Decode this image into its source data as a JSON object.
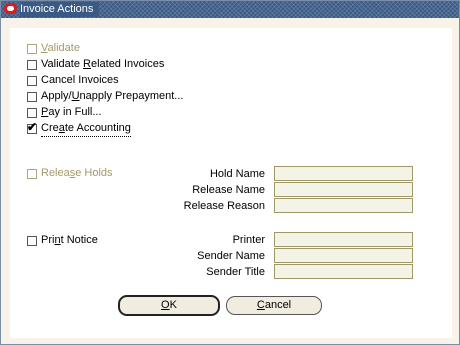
{
  "window": {
    "title": "Invoice Actions"
  },
  "options": [
    {
      "pre": "",
      "mnemonic": "V",
      "post": "alidate",
      "checked": false,
      "enabled": false
    },
    {
      "pre": "Validate ",
      "mnemonic": "R",
      "post": "elated Invoices",
      "checked": false,
      "enabled": true
    },
    {
      "pre": "Cancel Invoices",
      "mnemonic": "",
      "post": "",
      "checked": false,
      "enabled": true
    },
    {
      "pre": "Apply/",
      "mnemonic": "U",
      "post": "napply Prepayment...",
      "checked": false,
      "enabled": true
    },
    {
      "pre": "",
      "mnemonic": "P",
      "post": "ay in Full...",
      "checked": false,
      "enabled": true
    },
    {
      "pre": "Cre",
      "mnemonic": "a",
      "post": "te Accounting",
      "checked": true,
      "enabled": true,
      "focused": true
    }
  ],
  "release_holds": {
    "pre": "Relea",
    "mnemonic": "s",
    "post": "e Holds",
    "checked": false,
    "enabled": false,
    "fields": [
      {
        "label": "Hold Name",
        "value": ""
      },
      {
        "label": "Release Name",
        "value": ""
      },
      {
        "label": "Release Reason",
        "value": ""
      }
    ]
  },
  "print_notice": {
    "pre": "Pri",
    "mnemonic": "n",
    "post": "t Notice",
    "checked": false,
    "enabled": true,
    "fields": [
      {
        "label": "Printer",
        "value": ""
      },
      {
        "label": "Sender Name",
        "value": ""
      },
      {
        "label": "Sender Title",
        "value": ""
      }
    ]
  },
  "buttons": {
    "ok": {
      "pre": "",
      "mnemonic": "O",
      "post": "K"
    },
    "cancel": {
      "pre": "",
      "mnemonic": "C",
      "post": "ancel"
    }
  }
}
